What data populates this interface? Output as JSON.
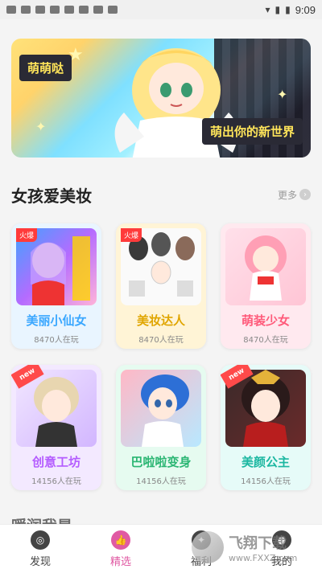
{
  "status": {
    "time": "9:09"
  },
  "banner": {
    "tag_top": "萌萌哒",
    "tag_bottom": "萌出你的新世界"
  },
  "section": {
    "title": "女孩爱美妆",
    "more": "更多"
  },
  "cards": [
    {
      "name": "美丽小仙女",
      "players": "8470人在玩",
      "badge": "火爆",
      "name_color": "#3aa7ff",
      "bg": "#e9f5ff"
    },
    {
      "name": "美妆达人",
      "players": "8470人在玩",
      "badge": "火爆",
      "name_color": "#e0a500",
      "bg": "#fff4d6"
    },
    {
      "name": "萌装少女",
      "players": "8470人在玩",
      "badge": "",
      "name_color": "#ff5a7a",
      "bg": "#ffe9ef"
    },
    {
      "name": "创意工坊",
      "players": "14156人在玩",
      "badge": "new",
      "name_color": "#b45cff",
      "bg": "#f3e9ff"
    },
    {
      "name": "巴啦啦变身",
      "players": "14156人在玩",
      "badge": "",
      "name_color": "#2bb673",
      "bg": "#e6fbf0"
    },
    {
      "name": "美颜公主",
      "players": "14156人在玩",
      "badge": "new",
      "name_color": "#1bb7a1",
      "bg": "#e6fbf8"
    }
  ],
  "teaser": "暖润我是",
  "tabs": [
    {
      "label": "发现",
      "icon": "compass-icon"
    },
    {
      "label": "精选",
      "icon": "thumbs-up-icon"
    },
    {
      "label": "福利",
      "icon": "gift-icon"
    },
    {
      "label": "我的",
      "icon": "user-icon"
    }
  ],
  "watermark": {
    "title": "飞翔下载",
    "sub": "www.FXXZ.com"
  }
}
